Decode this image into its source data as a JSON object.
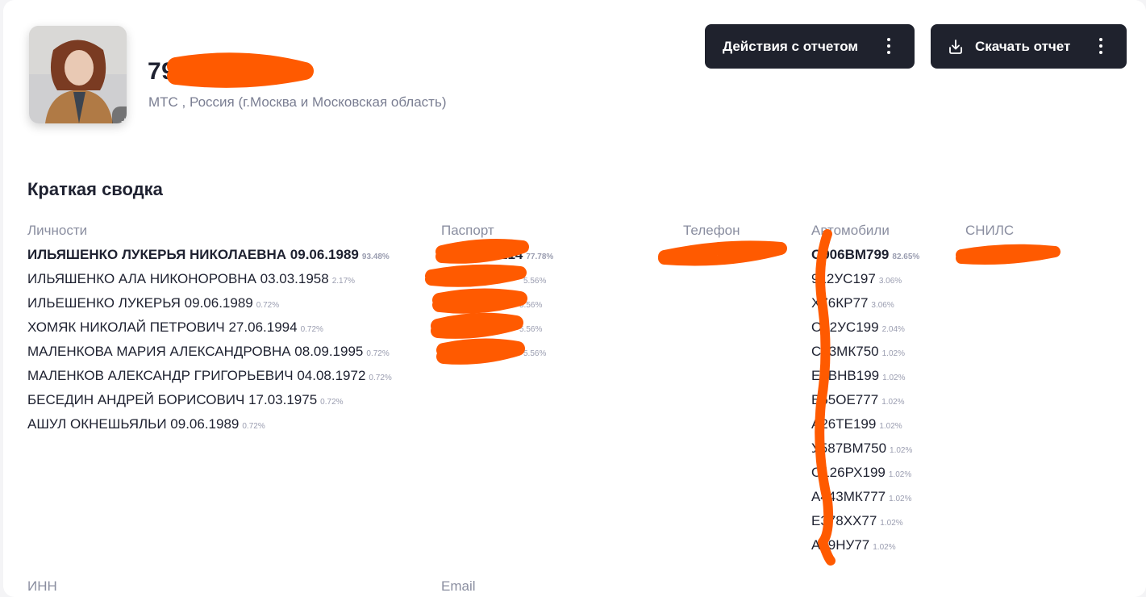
{
  "header": {
    "phone_visible": "79",
    "operator": "МТС , Россия (г.Москва и Московская область)",
    "avatar_extra_count": "+2",
    "actions_button": "Действия с отчетом",
    "download_button": "Скачать отчет"
  },
  "summary": {
    "title": "Краткая сводка",
    "columns": {
      "persons": "Личности",
      "passport": "Паспорт",
      "phone": "Телефон",
      "cars": "Автомобили",
      "snils": "СНИЛС"
    },
    "persons": [
      {
        "name": "ИЛЬЯШЕНКО ЛУКЕРЬЯ НИКОЛАЕВНА 09.06.1989",
        "pct": "93.48%"
      },
      {
        "name": "ИЛЬЯШЕНКО АЛА НИКОНОРОВНА 03.03.1958",
        "pct": "2.17%"
      },
      {
        "name": "ИЛЬЕШЕНКО ЛУКЕРЬЯ 09.06.1989",
        "pct": "0.72%"
      },
      {
        "name": "ХОМЯК НИКОЛАЙ ПЕТРОВИЧ 27.06.1994",
        "pct": "0.72%"
      },
      {
        "name": "МАЛЕНКОВА МАРИЯ АЛЕКСАНДРОВНА 08.09.1995",
        "pct": "0.72%"
      },
      {
        "name": "МАЛЕНКОВ АЛЕКСАНДР ГРИГОРЬЕВИЧ 04.08.1972",
        "pct": "0.72%"
      },
      {
        "name": "БЕСЕДИН АНДРЕЙ БОРИСОВИЧ 17.03.1975",
        "pct": "0.72%"
      },
      {
        "name": "АШУЛ ОКНЕШЬЯЛЬИ 09.06.1989",
        "pct": "0.72%"
      }
    ],
    "passports": [
      {
        "value": "214",
        "pct": "77.78%"
      },
      {
        "value": "",
        "pct": "5.56%"
      },
      {
        "value": "",
        "pct": "5.56%"
      },
      {
        "value": "",
        "pct": "5.56%"
      },
      {
        "value": "",
        "pct": "5.56%"
      }
    ],
    "cars": [
      {
        "plate": "О906ВМ799",
        "pct": "82.65%"
      },
      {
        "plate": "912УС197",
        "pct": "3.06%"
      },
      {
        "plate": "Х76КР77",
        "pct": "3.06%"
      },
      {
        "plate": "О62УС199",
        "pct": "2.04%"
      },
      {
        "plate": "С63МК750",
        "pct": "1.02%"
      },
      {
        "plate": "Е1ВНВ199",
        "pct": "1.02%"
      },
      {
        "plate": "В55ОЕ777",
        "pct": "1.02%"
      },
      {
        "plate": "А26ТЕ199",
        "pct": "1.02%"
      },
      {
        "plate": "У587ВМ750",
        "pct": "1.02%"
      },
      {
        "plate": "О126РХ199",
        "pct": "1.02%"
      },
      {
        "plate": "А443МК777",
        "pct": "1.02%"
      },
      {
        "plate": "Е378ХХ77",
        "pct": "1.02%"
      },
      {
        "plate": "А79НУ77",
        "pct": "1.02%"
      }
    ],
    "bottom_columns": {
      "inn": "ИНН",
      "email": "Email"
    }
  },
  "colors": {
    "button_bg": "#1f222d",
    "redaction": "#ff5a00",
    "muted_text": "#8a8ea0"
  }
}
